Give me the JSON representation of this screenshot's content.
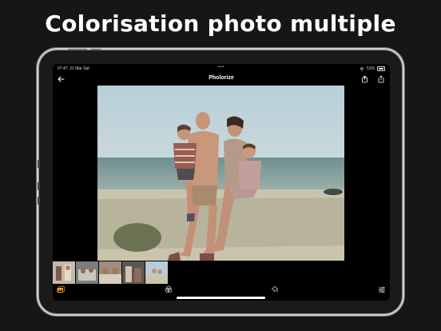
{
  "headline": "Colorisation photo multiple",
  "status_bar": {
    "time": "07:47",
    "date": "21 Mar Sat",
    "battery": "51%"
  },
  "nav": {
    "title": "Pholorize",
    "back_icon": "back-arrow-icon",
    "action_icons": [
      "compare-icon",
      "share-icon"
    ]
  },
  "main_photo": {
    "description_icon": "colorized-family-photo"
  },
  "thumbnails": [
    {
      "name": "thumb-1"
    },
    {
      "name": "thumb-2"
    },
    {
      "name": "thumb-3"
    },
    {
      "name": "thumb-4"
    },
    {
      "name": "thumb-5"
    }
  ],
  "toolbar": {
    "icons": [
      "gallery-icon",
      "color-filter-icon",
      "paint-bucket-icon",
      "sliders-icon"
    ]
  },
  "colors": {
    "accent": "#e8a020",
    "background": "#000000",
    "device_frame": "#1a1a1a"
  }
}
